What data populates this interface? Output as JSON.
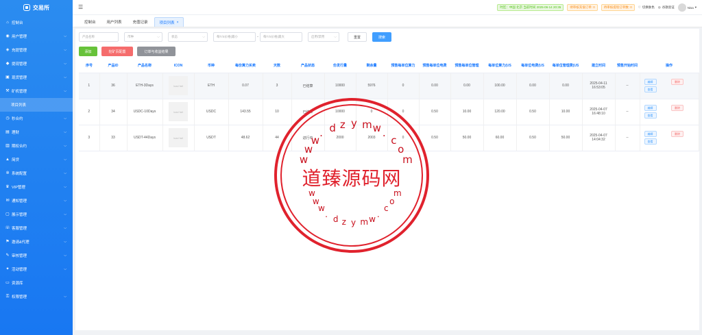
{
  "app": {
    "logo_text": "交易所"
  },
  "sidebar": {
    "items": [
      {
        "label": "控制台",
        "icon": "home-icon",
        "chevron": false
      },
      {
        "label": "用户管理",
        "icon": "user-icon",
        "chevron": true
      },
      {
        "label": "充提管理",
        "icon": "wallet-icon",
        "chevron": true
      },
      {
        "label": "提现管理",
        "icon": "withdraw-icon",
        "chevron": true
      },
      {
        "label": "现货管理",
        "icon": "spot-icon",
        "chevron": true
      },
      {
        "label": "矿机管理",
        "icon": "miner-icon",
        "chevron": true
      },
      {
        "label": "项目列表",
        "icon": "",
        "chevron": false,
        "sub": true
      },
      {
        "label": "秒合约",
        "icon": "clock-icon",
        "chevron": true
      },
      {
        "label": "理财",
        "icon": "finance-icon",
        "chevron": true
      },
      {
        "label": "期权合约",
        "icon": "option-icon",
        "chevron": true
      },
      {
        "label": "简贷",
        "icon": "loan-icon",
        "chevron": true
      },
      {
        "label": "系统配置",
        "icon": "gear-icon",
        "chevron": true
      },
      {
        "label": "VIP管理",
        "icon": "vip-icon",
        "chevron": true
      },
      {
        "label": "通知管理",
        "icon": "bell-icon",
        "chevron": true
      },
      {
        "label": "展示管理",
        "icon": "display-icon",
        "chevron": true
      },
      {
        "label": "客服管理",
        "icon": "service-icon",
        "chevron": true
      },
      {
        "label": "邀请&代理",
        "icon": "invite-icon",
        "chevron": true
      },
      {
        "label": "审核管理",
        "icon": "audit-icon",
        "chevron": true
      },
      {
        "label": "活动管理",
        "icon": "activity-icon",
        "chevron": true
      },
      {
        "label": "资源库",
        "icon": "folder-icon",
        "chevron": false
      },
      {
        "label": "权限管理",
        "icon": "lock-icon",
        "chevron": true
      }
    ]
  },
  "topbar": {
    "region_pill": "时区：中国 北京 当前时间 2025-06-14 20:35",
    "orders_pill": "待审核充值订单: 0",
    "withdraw_pill": "待审核提现订单数: 0",
    "toggle_lang": "切换肤色",
    "verify": "谷歌验证",
    "username": "Nisa"
  },
  "tabs": [
    {
      "label": "控制台",
      "active": false
    },
    {
      "label": "用户列表",
      "active": false
    },
    {
      "label": "充值记录",
      "active": false
    },
    {
      "label": "项目列表",
      "active": true,
      "close": "×"
    }
  ],
  "filters": {
    "product_name": "产品名称",
    "currency": "币种",
    "status": "状态",
    "min_price": "每T/S价格(最小",
    "max_price": "每T/S价格(最大",
    "enabled": "启用/禁用",
    "dash": "-",
    "reset": "重置",
    "search": "搜索"
  },
  "actions": {
    "add": "添加",
    "mining_config": "挖矿页配置",
    "orders": "订单与收益结果"
  },
  "table": {
    "headers": [
      "序号",
      "产品ID",
      "产品名称",
      "ICON",
      "币种",
      "每份算力买卖",
      "天数",
      "产品状态",
      "份发行量",
      "剩余量",
      "预售每单位算力",
      "预售每单位电费",
      "预售每单位管理",
      "每单位算力(US",
      "每单位电费(US",
      "每单位管理费(US",
      "建立时间",
      "预售开始时间",
      "操作"
    ],
    "rows": [
      {
        "no": "1",
        "id": "36",
        "name": "ETH-3Days",
        "icon": "load fail",
        "coin": "ETH",
        "power": "0.07",
        "days": "3",
        "status": "已结算",
        "issue": "10000",
        "remain": "5976",
        "pre_power": "0",
        "pre_elec": "0.00",
        "pre_mgmt": "0.00",
        "unit_power": "100.00",
        "unit_elec": "0.00",
        "unit_mgmt": "0.00",
        "created": "2025-04-11 16:53:05",
        "presale": "--",
        "op_edit": "编辑",
        "op_view": "查看",
        "op_del": "删除"
      },
      {
        "no": "2",
        "id": "34",
        "name": "USDC-10Days",
        "icon": "load fail",
        "coin": "USDC",
        "power": "143.55",
        "days": "10",
        "status": "已结算",
        "issue": "10000",
        "remain": "0",
        "pre_power": "0",
        "pre_elec": "0.50",
        "pre_mgmt": "10.00",
        "unit_power": "120.00",
        "unit_elec": "0.50",
        "unit_mgmt": "10.00",
        "created": "2025-04-07 16:48:10",
        "presale": "--",
        "op_edit": "编辑",
        "op_view": "查看",
        "op_del": "删除"
      },
      {
        "no": "3",
        "id": "33",
        "name": "USDT-44Days",
        "icon": "load fail",
        "coin": "USDT",
        "power": "48.62",
        "days": "44",
        "status": "进行中",
        "issue": "2000",
        "remain": "2003",
        "pre_power": "0",
        "pre_elec": "0.50",
        "pre_mgmt": "50.00",
        "unit_power": "60.00",
        "unit_elec": "0.50",
        "unit_mgmt": "50.00",
        "created": "2025-04-07 14:04:32",
        "presale": "--",
        "op_edit": "编辑",
        "op_view": "查看",
        "op_del": "删除"
      }
    ]
  },
  "watermark": {
    "title": "道臻源码网",
    "top_chars": [
      "w",
      "w",
      "w",
      ".",
      "d",
      "z",
      "y",
      "m",
      "w",
      ".",
      "c",
      "o",
      "m"
    ],
    "bottom_chars": [
      "w",
      "w",
      "w",
      ".",
      "d",
      "z",
      "y",
      "m",
      "w",
      ".",
      "c",
      "o",
      "m"
    ],
    "color": "#e0222d"
  }
}
